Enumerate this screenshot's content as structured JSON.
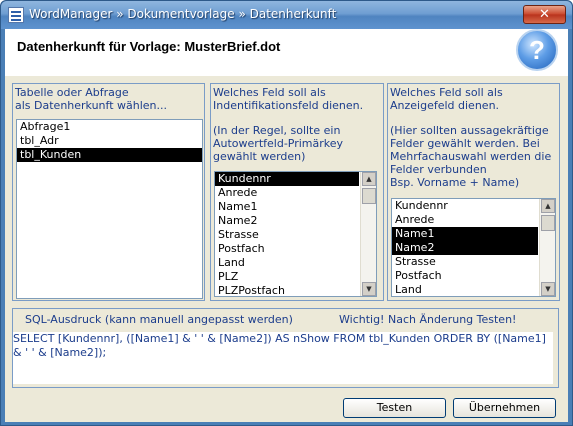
{
  "window": {
    "title": "WordManager » Dokumentvorlage » Datenherkunft",
    "close_label": "✕"
  },
  "header": {
    "title": "Datenherkunft für Vorlage: MusterBrief.dot",
    "help_label": "?"
  },
  "panels": {
    "source": {
      "label": "Tabelle oder Abfrage\nals Datenherkunft wählen...",
      "items": [
        "Abfrage1",
        "tbl_Adr",
        "tbl_Kunden"
      ],
      "selected": [
        2
      ]
    },
    "id_field": {
      "label": "Welches Feld soll als\nIndentifikationsfeld dienen.",
      "hint": "(In der Regel, sollte ein\nAutowertfeld-Primärkey\ngewählt werden)",
      "items": [
        "Kundennr",
        "Anrede",
        "Name1",
        "Name2",
        "Strasse",
        "Postfach",
        "Land",
        "PLZ",
        "PLZPostfach"
      ],
      "selected": [
        0
      ]
    },
    "display_field": {
      "label": "Welches Feld soll als\nAnzeigefeld dienen.",
      "hint": "(Hier sollten aussagekräftige\nFelder gewählt werden. Bei\nMehrfachauswahl werden die\nFelder verbunden\nBsp. Vorname + Name)",
      "items": [
        "Kundennr",
        "Anrede",
        "Name1",
        "Name2",
        "Strasse",
        "Postfach",
        "Land"
      ],
      "selected": [
        2,
        3
      ]
    }
  },
  "sql": {
    "label": "SQL-Ausdruck (kann manuell angepasst werden)",
    "warning": "Wichtig! Nach Änderung Testen!",
    "text": "SELECT [Kundennr], ([Name1] & ' ' & [Name2]) AS nShow FROM tbl_Kunden ORDER BY ([Name1] & ' ' & [Name2]);"
  },
  "buttons": {
    "test_label": "Testen",
    "apply_label": "Übernehmen"
  }
}
